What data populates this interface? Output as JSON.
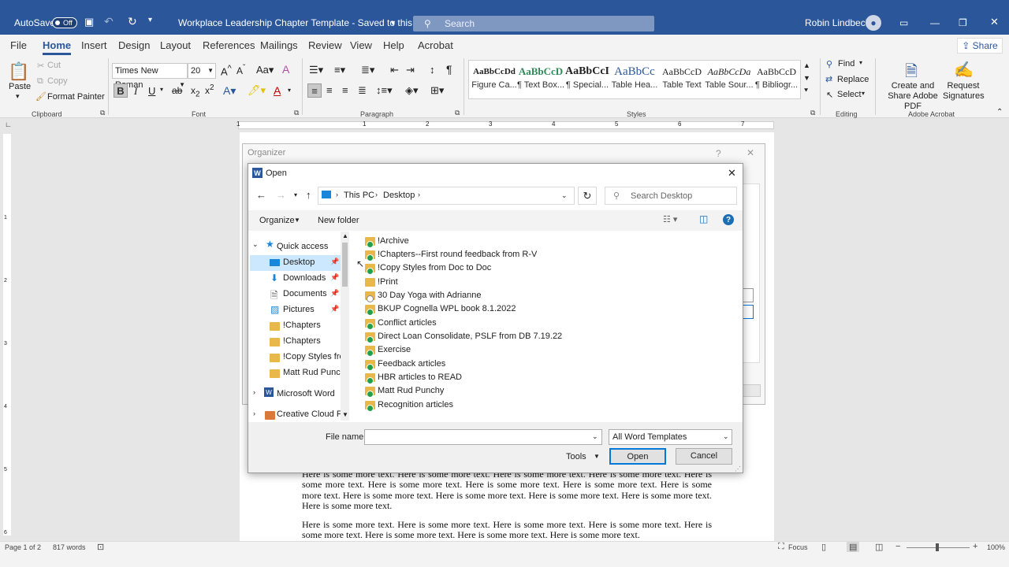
{
  "titlebar": {
    "autosave_label": "AutoSave",
    "autosave_state": "Off",
    "doc_title": "Workplace Leadership Chapter Template - Saved to this PC",
    "search_placeholder": "Search",
    "user_name": "Robin Lindbeck",
    "accent": "#2b579a"
  },
  "tabs": [
    "File",
    "Home",
    "Insert",
    "Design",
    "Layout",
    "References",
    "Mailings",
    "Review",
    "View",
    "Help",
    "Acrobat"
  ],
  "share_label": "Share",
  "ribbon": {
    "clipboard": {
      "paste": "Paste",
      "cut": "Cut",
      "copy": "Copy",
      "format_painter": "Format Painter",
      "group": "Clipboard"
    },
    "font": {
      "name": "Times New Roman",
      "size": "20",
      "group": "Font"
    },
    "paragraph": {
      "group": "Paragraph"
    },
    "styles": {
      "group": "Styles",
      "items": [
        {
          "preview": "AaBbCcDd",
          "name": "Figure Ca..."
        },
        {
          "preview": "AaBbCcD",
          "name": "¶ Text Box..."
        },
        {
          "preview": "AaBbCcI",
          "name": "¶ Special..."
        },
        {
          "preview": "AaBbCc",
          "name": "Table Hea..."
        },
        {
          "preview": "AaBbCcD",
          "name": "Table Text"
        },
        {
          "preview": "AaBbCcDa",
          "name": "Table Sour..."
        },
        {
          "preview": "AaBbCcD",
          "name": "¶ Bibliogr..."
        }
      ]
    },
    "editing": {
      "find": "Find",
      "replace": "Replace",
      "select": "Select",
      "group": "Editing"
    },
    "acrobat": {
      "create_share": "Create and Share Adobe PDF",
      "request_signatures": "Request Signatures",
      "group": "Adobe Acrobat"
    }
  },
  "ruler_marks": [
    "1",
    "1",
    "2",
    "3",
    "4",
    "5",
    "6",
    "7"
  ],
  "vruler_marks": [
    "1",
    "2",
    "3",
    "4",
    "5",
    "6"
  ],
  "organizer_title": "Organizer",
  "open_dialog": {
    "title": "Open",
    "path": [
      "This PC",
      "Desktop"
    ],
    "search_placeholder": "Search Desktop",
    "organize": "Organize",
    "new_folder": "New folder",
    "nav": [
      {
        "label": "Quick access"
      },
      {
        "label": "Desktop"
      },
      {
        "label": "Downloads"
      },
      {
        "label": "Documents"
      },
      {
        "label": "Pictures"
      },
      {
        "label": "!Chapters"
      },
      {
        "label": "!Chapters"
      },
      {
        "label": "!Copy Styles from"
      },
      {
        "label": "Matt Rud Punchy"
      },
      {
        "label": "Microsoft Word"
      },
      {
        "label": "Creative Cloud File"
      }
    ],
    "files": [
      "!Archive",
      "!Chapters--First round feedback from R-V",
      "!Copy Styles from Doc to Doc",
      "!Print",
      "30 Day Yoga with Adrianne",
      "BKUP Cognella WPL book 8.1.2022",
      "Conflict articles",
      "Direct Loan Consolidate, PSLF from DB 7.19.22",
      "Exercise",
      "Feedback articles",
      "HBR articles to READ",
      "Matt Rud Punchy",
      "Recognition articles"
    ],
    "file_name_label": "File name:",
    "file_name_value": "",
    "file_type": "All Word Templates",
    "tools": "Tools",
    "open_btn": "Open",
    "cancel_btn": "Cancel"
  },
  "document": {
    "para1": "Here is some more text. Here is some more text. Here is some more text. Here is some more text. Here is some more text. Here is some more text. Here is some more text. Here is some more text. Here is some more text. Here is some more text. Here is some more text. Here is some more text. Here is some more text. Here is some more text.",
    "para2": "Here is some more text. Here is some more text. Here is some more text. Here is some more text. Here is some more text. Here is some more text. Here is some more text. Here is some more text."
  },
  "statusbar": {
    "page": "Page 1 of 2",
    "words": "817 words",
    "focus": "Focus",
    "zoom": "100%"
  }
}
